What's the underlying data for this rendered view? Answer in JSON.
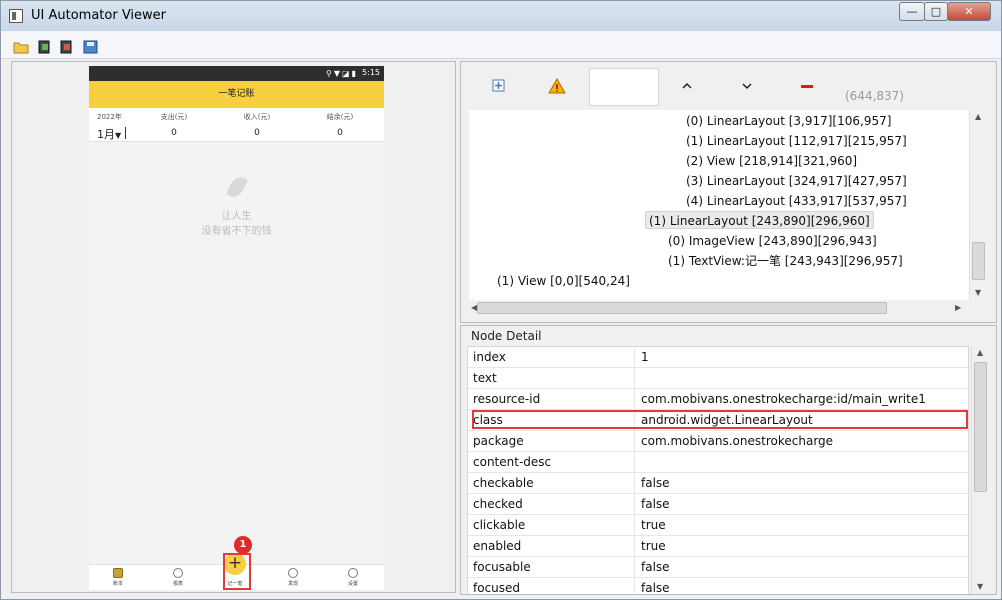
{
  "window": {
    "title": "UI Automator Viewer",
    "minimize": "—",
    "maximize": "□",
    "close": "✕"
  },
  "toolbar": {
    "icons": [
      "open-folder-icon",
      "device-screenshot-icon",
      "device-screenshot-compressed-icon",
      "save-icon"
    ]
  },
  "device": {
    "status_time": "5:15",
    "app_title": "一笔记账",
    "year": "2022年",
    "month": "1月",
    "month_arrow": "▼",
    "columns": [
      {
        "label": "支出(元)",
        "value": "0"
      },
      {
        "label": "收入(元)",
        "value": "0"
      },
      {
        "label": "结余(元)",
        "value": "0"
      }
    ],
    "empty_line1": "让人生",
    "empty_line2": "没有省不下的钱",
    "nav": [
      "账本",
      "报表",
      "记一笔",
      "发现",
      "设置"
    ],
    "add_symbol": "+",
    "step_badge": "1"
  },
  "tree": {
    "coords": "(644,837)",
    "rows": [
      "(0) LinearLayout [3,917][106,957]",
      "(1) LinearLayout [112,917][215,957]",
      "(2) View [218,914][321,960]",
      "(3) LinearLayout [324,917][427,957]",
      "(4) LinearLayout [433,917][537,957]",
      "(1) LinearLayout [243,890][296,960]",
      "(0) ImageView [243,890][296,943]",
      "(1) TextView:记一笔 [243,943][296,957]",
      "(1) View [0,0][540,24]"
    ]
  },
  "node_detail": {
    "title": "Node Detail",
    "rows": [
      {
        "key": "index",
        "value": "1"
      },
      {
        "key": "text",
        "value": ""
      },
      {
        "key": "resource-id",
        "value": "com.mobivans.onestrokecharge:id/main_write1"
      },
      {
        "key": "class",
        "value": "android.widget.LinearLayout"
      },
      {
        "key": "package",
        "value": "com.mobivans.onestrokecharge"
      },
      {
        "key": "content-desc",
        "value": ""
      },
      {
        "key": "checkable",
        "value": "false"
      },
      {
        "key": "checked",
        "value": "false"
      },
      {
        "key": "clickable",
        "value": "true"
      },
      {
        "key": "enabled",
        "value": "true"
      },
      {
        "key": "focusable",
        "value": "false"
      },
      {
        "key": "focused",
        "value": "false"
      }
    ]
  }
}
